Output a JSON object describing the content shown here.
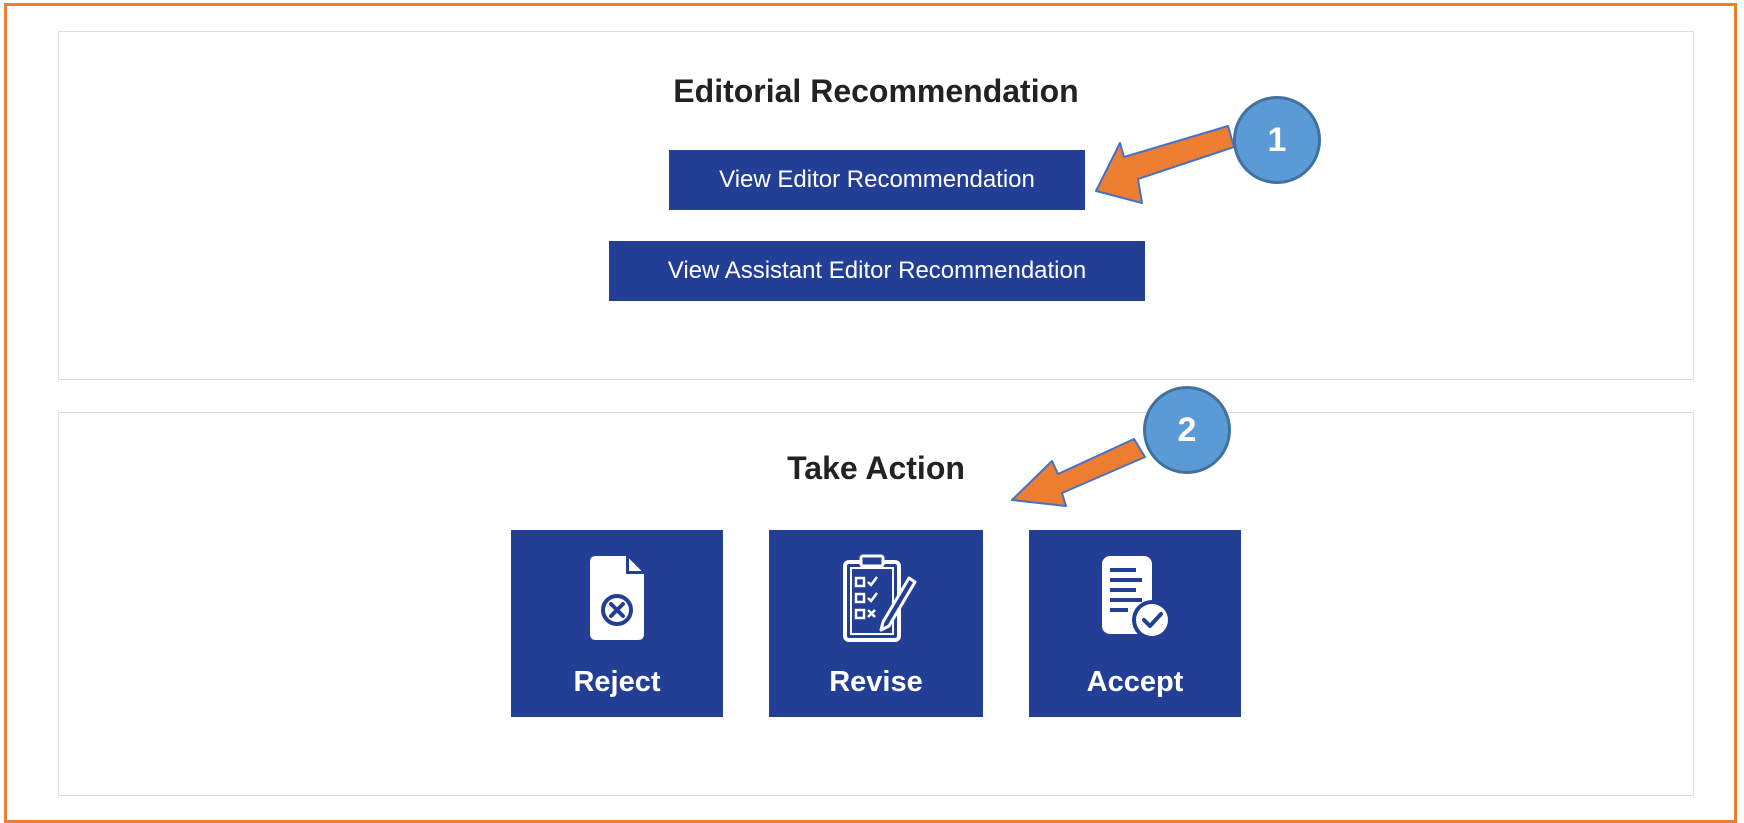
{
  "editorial_section": {
    "title": "Editorial Recommendation",
    "view_editor_label": "View Editor Recommendation",
    "view_assistant_label": "View Assistant Editor Recommendation"
  },
  "action_section": {
    "title": "Take Action",
    "tiles": [
      {
        "label": "Reject",
        "icon": "document-x-icon"
      },
      {
        "label": "Revise",
        "icon": "clipboard-checklist-icon"
      },
      {
        "label": "Accept",
        "icon": "document-check-icon"
      }
    ]
  },
  "annotations": {
    "callout_1": "1",
    "callout_2": "2"
  },
  "colors": {
    "button_blue": "#233f95",
    "frame_orange": "#ed7d31",
    "callout_blue": "#5b9bd5",
    "arrow_orange": "#ed7d31"
  }
}
